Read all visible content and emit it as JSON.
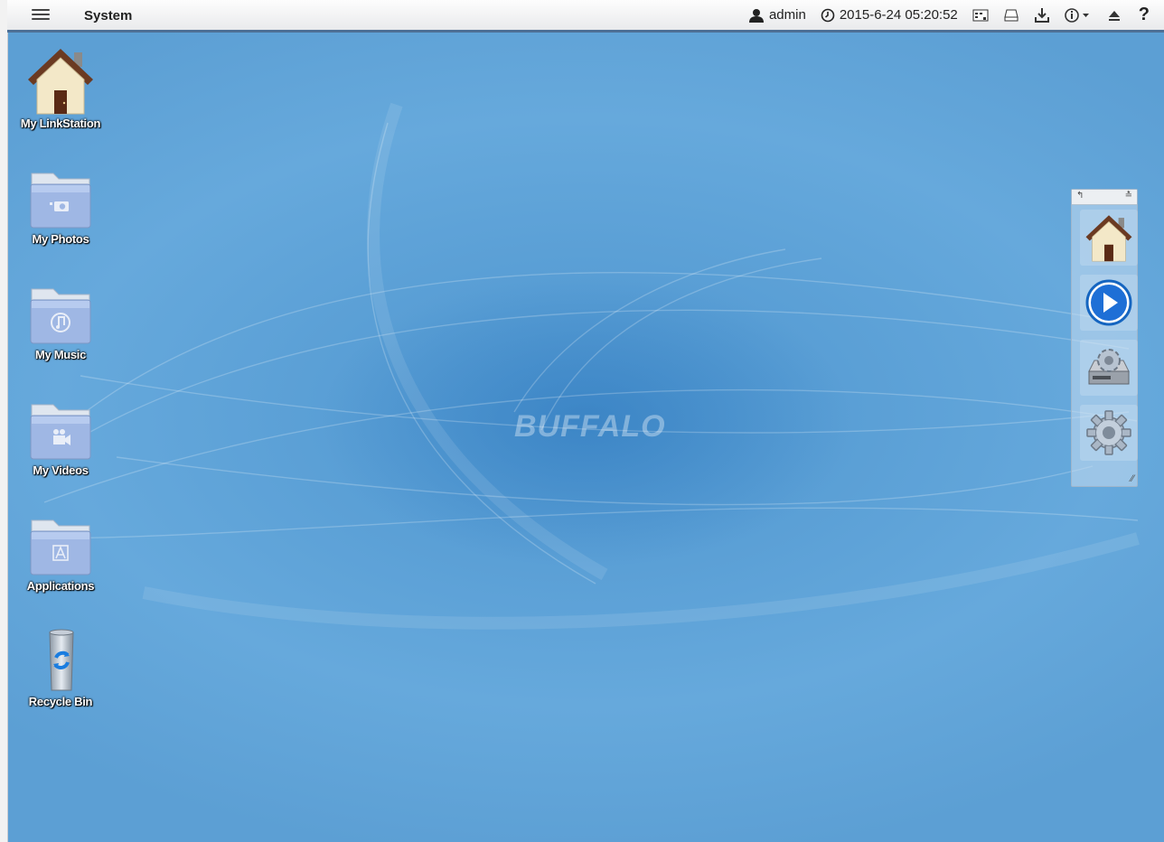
{
  "topbar": {
    "title": "System",
    "user": "admin",
    "datetime": "2015-6-24 05:20:52",
    "help_label": "?"
  },
  "desktop": {
    "brand": "BUFFALO",
    "icons": [
      {
        "label": "My LinkStation",
        "icon": "home-icon"
      },
      {
        "label": "My Photos",
        "icon": "photos-folder-icon"
      },
      {
        "label": "My Music",
        "icon": "music-folder-icon"
      },
      {
        "label": "My Videos",
        "icon": "videos-folder-icon"
      },
      {
        "label": "Applications",
        "icon": "applications-folder-icon"
      },
      {
        "label": "Recycle Bin",
        "icon": "recycle-bin-icon"
      }
    ]
  },
  "dock": {
    "back_glyph": "↰",
    "collapse_glyph": "≛",
    "items": [
      "home-icon",
      "play-icon",
      "drive-settings-icon",
      "settings-gear-icon"
    ]
  },
  "colors": {
    "desktop_blue": "#5c9fd4",
    "topbar_border": "#4d6f95",
    "folder_blue": "#9fb7e4"
  }
}
